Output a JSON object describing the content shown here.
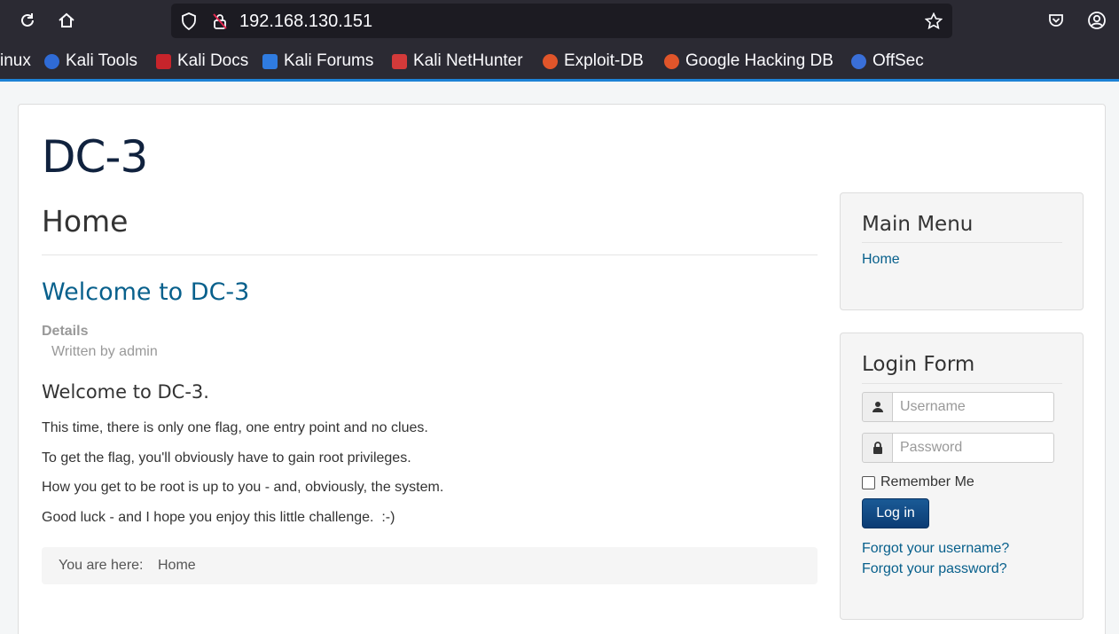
{
  "browser": {
    "url": "192.168.130.151",
    "bookmarks": [
      {
        "label": "inux",
        "color": ""
      },
      {
        "label": "Kali Tools",
        "color": "#2f6bd6"
      },
      {
        "label": "Kali Docs",
        "color": "#c7242b"
      },
      {
        "label": "Kali Forums",
        "color": "#2f7be0"
      },
      {
        "label": "Kali NetHunter",
        "color": "#d33a3a"
      },
      {
        "label": "Exploit-DB",
        "color": "#e0552a"
      },
      {
        "label": "Google Hacking DB",
        "color": "#e0552a"
      },
      {
        "label": "OffSec",
        "color": "#3a6fd8"
      }
    ]
  },
  "site": {
    "title": "DC-3"
  },
  "main": {
    "page_heading": "Home",
    "article": {
      "title": "Welcome to DC-3",
      "details_label": "Details",
      "written_by": "Written by admin",
      "heading": "Welcome to DC-3.",
      "paragraphs": [
        "This time, there is only one flag, one entry point and no clues.",
        "To get the flag, you'll obviously have to gain root privileges.",
        "How you get to be root is up to you - and, obviously, the system.",
        "Good luck - and I hope you enjoy this little challenge.  :-)"
      ]
    },
    "breadcrumb": {
      "label": "You are here:",
      "current": "Home"
    }
  },
  "sidebar": {
    "main_menu": {
      "title": "Main Menu",
      "items": [
        "Home"
      ]
    },
    "login_form": {
      "title": "Login Form",
      "username_placeholder": "Username",
      "password_placeholder": "Password",
      "remember_label": "Remember Me",
      "login_button": "Log in",
      "forgot_username": "Forgot your username?",
      "forgot_password": "Forgot your password?"
    }
  }
}
